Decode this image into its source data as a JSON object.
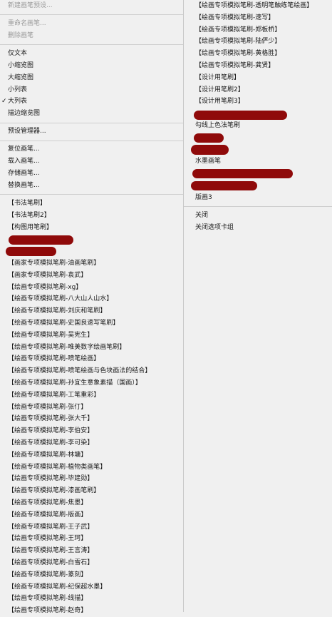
{
  "left_menu": {
    "group1": [
      "新建画笔预设..."
    ],
    "group2": [
      "重命名画笔...",
      "删除画笔"
    ],
    "view_modes": [
      {
        "label": "仅文本",
        "checked": false
      },
      {
        "label": "小缩览图",
        "checked": false
      },
      {
        "label": "大缩览图",
        "checked": false
      },
      {
        "label": "小列表",
        "checked": false
      },
      {
        "label": "大列表",
        "checked": true
      },
      {
        "label": "描边缩览图",
        "checked": false
      }
    ],
    "check_mark": "✓",
    "preset_manager": "预设管理器...",
    "brush_ops": [
      "复位画笔...",
      "载入画笔...",
      "存储画笔...",
      "替换画笔..."
    ],
    "brush_sets": [
      "【书法笔刷】",
      "【书法笔刷2】",
      "【构图用笔刷】",
      "",
      "",
      "【画家专项模拟笔刷-油画笔刷】",
      "【画家专项模拟笔刷-袁武】",
      "【绘画专项模拟笔刷-xg】",
      "【绘画专项模拟笔刷-八大山人山水】",
      "【绘画专项模拟笔刷-刘庆和笔刷】",
      "【绘画专项模拟笔刷-史国良速写笔刷】",
      "【绘画专项模拟笔刷-吴宪生】",
      "【绘画专项模拟笔刷-唯美数字绘画笔刷】",
      "【绘画专项模拟笔刷-喷笔绘画】",
      "【绘画专项模拟笔刷-喷笔绘画与色块画法的结合】",
      "【绘画专项模拟笔刷-孙宜生意象素描（国画）】",
      "【绘画专项模拟笔刷-工笔重彩】",
      "【绘画专项模拟笔刷-张仃】",
      "【绘画专项模拟笔刷-张大千】",
      "【绘画专项模拟笔刷-李伯安】",
      "【绘画专项模拟笔刷-李可染】",
      "【绘画专项模拟笔刷-林墉】",
      "【绘画专项模拟笔刷-植物类画笔】",
      "【绘画专项模拟笔刷-毕建勋】",
      "【绘画专项模拟笔刷-漆画笔刷】",
      "【绘画专项模拟笔刷-焦墨】",
      "【绘画专项模拟笔刷-版画】",
      "【绘画专项模拟笔刷-王子武】",
      "【绘画专项模拟笔刷-王珂】",
      "【绘画专项模拟笔刷-王言涛】",
      "【绘画专项模拟笔刷-白雪石】",
      "【绘画专项模拟笔刷-篆刻】",
      "【绘画专项模拟笔刷-纪保超水墨】",
      "【绘画专项模拟笔刷-线描】",
      "【绘画专项模拟笔刷-赵奇】"
    ]
  },
  "right_menu": {
    "brush_sets": [
      "【绘画专项模拟笔刷-透明笔触练笔绘画】",
      "【绘画专项模拟笔刷-速写】",
      "【绘画专项模拟笔刷-郑板桥】",
      "【绘画专项模拟笔刷-陆俨少】",
      "【绘画专项模拟笔刷-黄格胜】",
      "【绘画专项模拟笔刷-龚贤】",
      "【设计用笔刷】",
      "【设计用笔刷2】",
      "【设计用笔刷3】",
      "",
      "勾线上色法笔刷",
      "",
      "",
      "水墨画笔",
      "",
      "",
      "版画3"
    ],
    "close": "关闭",
    "close_tab_group": "关闭选项卡组"
  },
  "colors": {
    "menu_bg": "#f0f0f0",
    "redaction": "#8f0a0a",
    "disabled_text": "#9a9a9a"
  }
}
